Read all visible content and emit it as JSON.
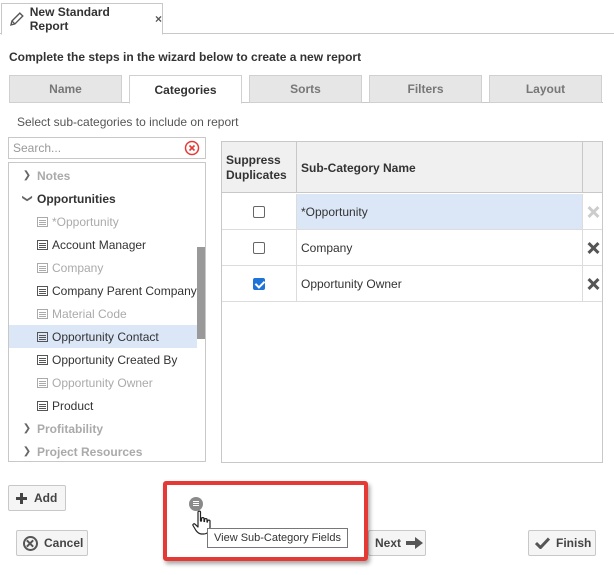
{
  "doc_tab": {
    "title": "New Standard Report",
    "close": "×"
  },
  "intro": "Complete the steps in the wizard below to create a new report",
  "wizard_tabs": [
    {
      "label": "Name"
    },
    {
      "label": "Categories"
    },
    {
      "label": "Sorts"
    },
    {
      "label": "Filters"
    },
    {
      "label": "Layout"
    }
  ],
  "active_tab": "Categories",
  "subcategory_prompt": "Select sub-categories to include on report",
  "search": {
    "placeholder": "Search...",
    "value": ""
  },
  "tree": [
    {
      "label": "Notes",
      "kind": "category",
      "expanded": false,
      "disabled": true
    },
    {
      "label": "Opportunities",
      "kind": "category",
      "expanded": true,
      "disabled": false
    },
    {
      "label": "*Opportunity",
      "kind": "field",
      "disabled": true
    },
    {
      "label": "Account Manager",
      "kind": "field",
      "disabled": false
    },
    {
      "label": "Company",
      "kind": "field",
      "disabled": true
    },
    {
      "label": "Company Parent Company",
      "kind": "field",
      "disabled": false
    },
    {
      "label": "Material Code",
      "kind": "field",
      "disabled": true
    },
    {
      "label": "Opportunity Contact",
      "kind": "field",
      "disabled": false,
      "selected": true
    },
    {
      "label": "Opportunity Created By",
      "kind": "field",
      "disabled": false
    },
    {
      "label": "Opportunity Owner",
      "kind": "field",
      "disabled": true
    },
    {
      "label": "Product",
      "kind": "field",
      "disabled": false
    },
    {
      "label": "Profitability",
      "kind": "category",
      "expanded": false,
      "disabled": true
    },
    {
      "label": "Project Resources",
      "kind": "category",
      "expanded": false,
      "disabled": true
    }
  ],
  "grid": {
    "headers": {
      "suppress_line1": "Suppress",
      "suppress_line2": "Duplicates",
      "name": "Sub-Category Name"
    },
    "rows": [
      {
        "name": "*Opportunity",
        "suppress": false,
        "removable": false,
        "highlight": true
      },
      {
        "name": "Company",
        "suppress": false,
        "removable": true,
        "highlight": false
      },
      {
        "name": "Opportunity Owner",
        "suppress": true,
        "removable": true,
        "highlight": false
      }
    ]
  },
  "buttons": {
    "add": "Add",
    "cancel": "Cancel",
    "next": "Next",
    "finish": "Finish"
  },
  "tooltip": "View Sub-Category Fields",
  "colors": {
    "highlight_border": "#e53935",
    "selection": "#dbe7f7",
    "checkbox_checked": "#1e73d8"
  }
}
